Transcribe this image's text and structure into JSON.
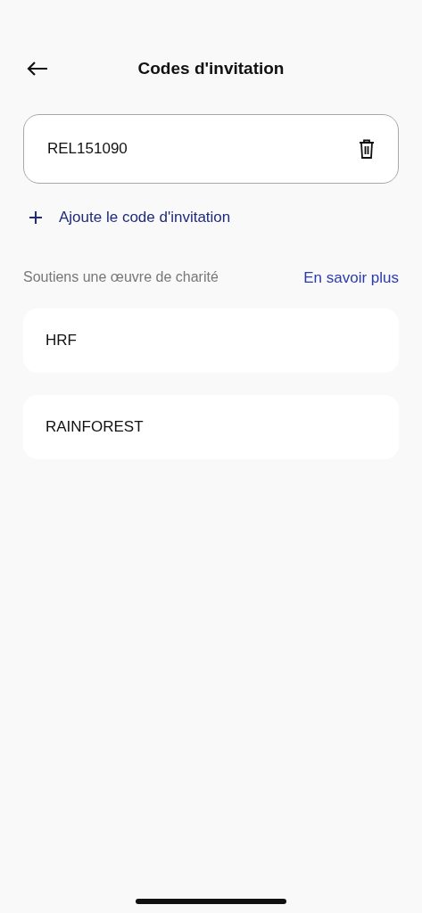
{
  "header": {
    "title": "Codes d'invitation"
  },
  "codes": [
    {
      "value": "REL151090"
    }
  ],
  "add_code": {
    "label": "Ajoute le code d'invitation"
  },
  "charity": {
    "heading": "Soutiens une œuvre de charité",
    "link": "En savoir plus",
    "items": [
      {
        "label": "HRF"
      },
      {
        "label": "RAINFOREST"
      }
    ]
  }
}
